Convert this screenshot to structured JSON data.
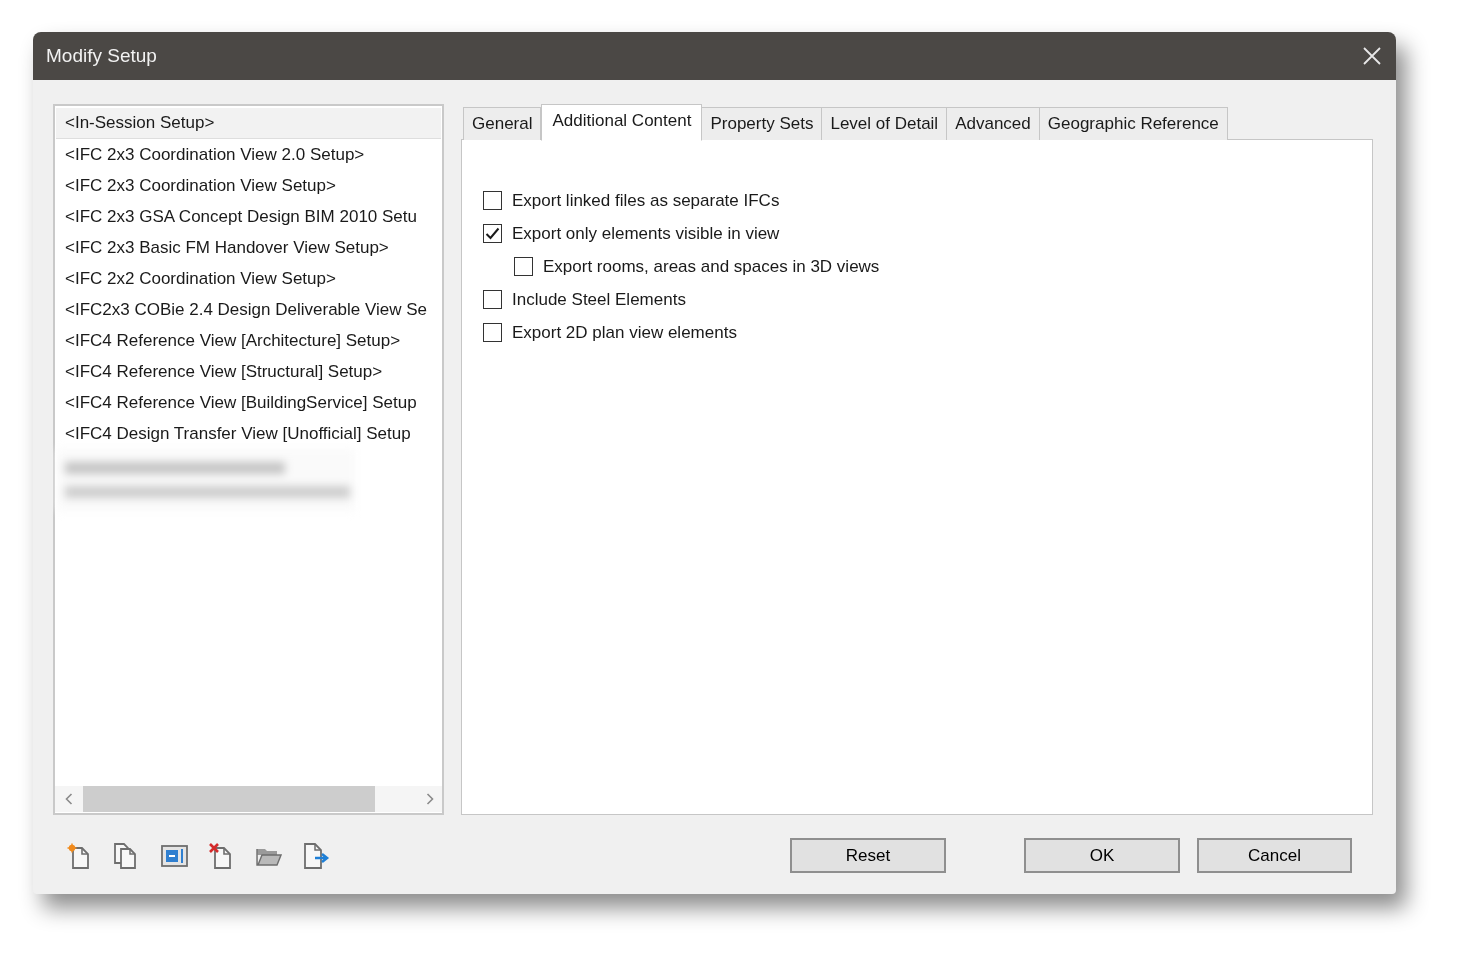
{
  "window": {
    "title": "Modify Setup"
  },
  "setups": [
    {
      "kind": "setup",
      "label": "<In-Session Setup>",
      "selected": true
    },
    {
      "kind": "setup",
      "label": "<IFC 2x3 Coordination View 2.0 Setup>",
      "selected": false
    },
    {
      "kind": "setup",
      "label": "<IFC 2x3 Coordination View Setup>",
      "selected": false
    },
    {
      "kind": "setup",
      "label": "<IFC 2x3 GSA Concept Design BIM 2010 Setu",
      "selected": false
    },
    {
      "kind": "setup",
      "label": "<IFC 2x3 Basic FM Handover View Setup>",
      "selected": false
    },
    {
      "kind": "setup",
      "label": "<IFC 2x2 Coordination View Setup>",
      "selected": false
    },
    {
      "kind": "setup",
      "label": "<IFC2x3 COBie 2.4 Design Deliverable View Se",
      "selected": false
    },
    {
      "kind": "setup",
      "label": "<IFC4 Reference View [Architecture] Setup>",
      "selected": false
    },
    {
      "kind": "setup",
      "label": "<IFC4 Reference View [Structural] Setup>",
      "selected": false
    },
    {
      "kind": "setup",
      "label": "<IFC4 Reference View [BuildingService] Setup",
      "selected": false
    },
    {
      "kind": "setup",
      "label": "<IFC4 Design Transfer View [Unofficial] Setup",
      "selected": false
    },
    {
      "kind": "blurred",
      "selected": false
    }
  ],
  "tabs": [
    {
      "label": "General",
      "selected": false
    },
    {
      "label": "Additional Content",
      "selected": true
    },
    {
      "label": "Property Sets",
      "selected": false
    },
    {
      "label": "Level of Detail",
      "selected": false
    },
    {
      "label": "Advanced",
      "selected": false
    },
    {
      "label": "Geographic Reference",
      "selected": false
    }
  ],
  "options": [
    {
      "label": "Export linked files as separate IFCs",
      "checked": false
    },
    {
      "label": "Export only elements visible in view",
      "checked": true,
      "children": [
        {
          "label": "Export rooms, areas and spaces in 3D views",
          "checked": false
        }
      ]
    },
    {
      "label": "Include Steel Elements",
      "checked": false
    },
    {
      "label": "Export 2D plan view elements",
      "checked": false
    }
  ],
  "reset_button": "Reset",
  "dialog_buttons": [
    "OK",
    "Cancel"
  ]
}
